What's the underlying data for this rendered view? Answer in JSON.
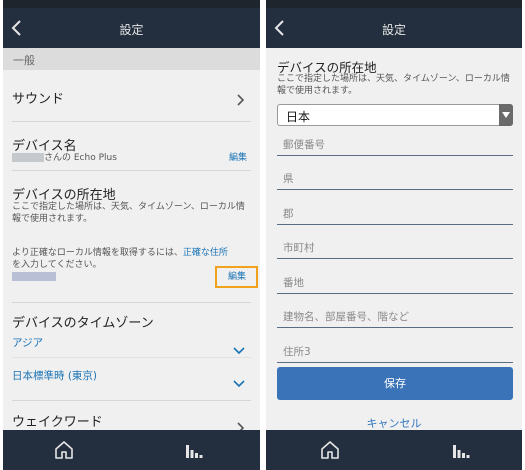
{
  "left": {
    "header_title": "設定",
    "section_label": "一般",
    "sound_label": "サウンド",
    "device_name": {
      "title": "デバイス名",
      "owner_suffix": "さんの Echo Plus",
      "edit": "編集"
    },
    "location": {
      "title": "デバイスの所在地",
      "desc": "ここで指定した場所は、天気、タイムゾーン、ローカル情報で使用されます。",
      "hint_plain": "より正確なローカル情報を取得するには、",
      "hint_link": "正確な住所",
      "hint_line2": "を入力してください。",
      "edit": "編集"
    },
    "timezone": {
      "title": "デバイスのタイムゾーン",
      "region": "アジア",
      "zone": "日本標準時 (東京)"
    },
    "wake_word": "ウェイクワード"
  },
  "right": {
    "header_title": "設定",
    "title": "デバイスの所在地",
    "desc": "ここで指定した場所は、天気、タイムゾーン、ローカル情報で使用されます。",
    "country_selected": "日本",
    "fields": [
      {
        "placeholder": "郵便番号"
      },
      {
        "placeholder": "県"
      },
      {
        "placeholder": "郡"
      },
      {
        "placeholder": "市町村"
      },
      {
        "placeholder": "番地"
      },
      {
        "placeholder": "建物名、部屋番号、階など"
      },
      {
        "placeholder": "住所3"
      }
    ],
    "save": "保存",
    "cancel": "キャンセル"
  },
  "colors": {
    "header": "#232f3e",
    "link": "#1a73b5",
    "highlight": "#f0a31a",
    "button": "#3a73b7"
  },
  "icons": [
    "back-icon",
    "chevron-right-icon",
    "chevron-down-icon",
    "home-icon",
    "bars-icon",
    "dropdown-caret-icon"
  ]
}
